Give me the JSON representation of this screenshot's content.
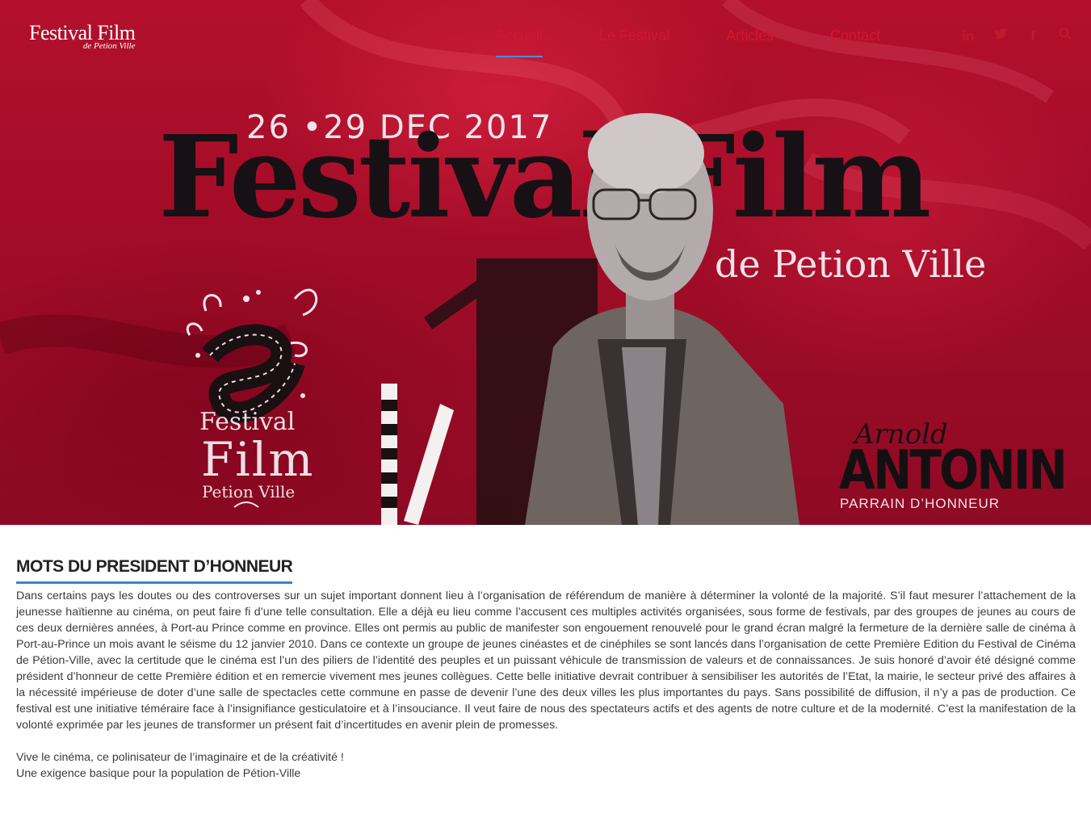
{
  "header": {
    "logo_main": "Festival Film",
    "logo_sub": "de Petion Ville",
    "nav": [
      "Accueil",
      "Le Festival",
      "Articles",
      "Contact"
    ],
    "active_nav": "Accueil",
    "social_icons": [
      "linkedin-icon",
      "twitter-icon",
      "facebook-icon",
      "search-icon"
    ]
  },
  "hero": {
    "date": "26 •29  DEC 2017",
    "title": "Festival Film",
    "subtitle": "de Petion Ville",
    "emblem_line1": "Festival",
    "emblem_line2": "Film",
    "emblem_line3": "Petion Ville",
    "person_first": "Arnold",
    "person_last": "ANTONIN",
    "person_role": "PARRAIN D’HONNEUR"
  },
  "article": {
    "heading": "MOTS DU PRESIDENT D’HONNEUR",
    "body": "Dans certains pays les doutes ou des controverses sur un sujet important donnent lieu à l’organisation de référendum de manière à déterminer la volonté de la majorité. S’il faut mesurer l’attachement de la jeunesse haïtienne au cinéma, on peut faire fi d’une telle consultation. Elle a déjà eu lieu comme l’accusent ces multiples activités organisées, sous forme de festivals, par des groupes de jeunes au cours de ces deux dernières années, à Port-au Prince comme en province. Elles ont permis au public de manifester son engouement renouvelé pour le grand écran malgré la fermeture de la dernière salle de cinéma à Port-au-Prince un mois avant le séisme du 12 janvier 2010. Dans ce contexte un groupe de jeunes cinéastes et de cinéphiles se sont lancés dans l’organisation de cette Première Edition du Festival de Cinéma de Pétion-Ville, avec la certitude que le cinéma est l’un des piliers de l’identité des peuples et un puissant véhicule de transmission de valeurs et de connaissances. Je suis honoré d’avoir été désigné comme président d’honneur de cette Première édition et en remercie vivement mes jeunes collègues. Cette belle initiative devrait contribuer à sensibiliser les autorités de l’Etat, la mairie, le secteur privé des affaires à la nécessité impérieuse de doter d’une salle de spectacles cette commune en passe de devenir l’une des deux villes les plus importantes du pays. Sans possibilité de diffusion, il n’y a pas de production. Ce festival est une initiative téméraire face à l’insignifiance gesticulatoire et à l’insouciance. Il veut faire de nous des spectateurs actifs et des agents de notre culture et de la modernité. C’est la manifestation de la volonté exprimée par les jeunes de transformer un présent fait d’incertitudes en avenir plein de promesses.",
    "closing_line1": "Vive le cinéma, ce polinisateur de l’imaginaire et de la créativité !",
    "closing_line2": "Une exigence basique pour la population de Pétion-Ville"
  },
  "colors": {
    "hero_red": "#a20c28",
    "nav_red": "#d4172f",
    "accent_blue": "#3c84c8"
  }
}
